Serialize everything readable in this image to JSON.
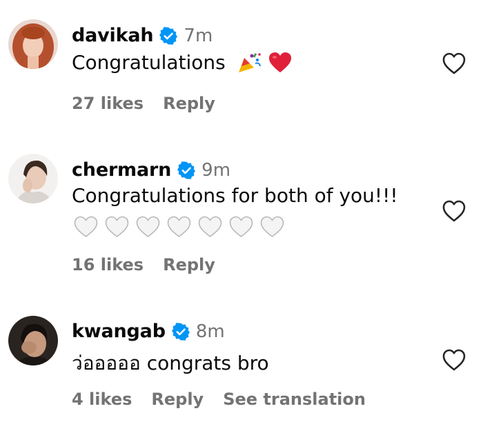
{
  "comments": [
    {
      "username": "davikah",
      "time": "7m",
      "text": "Congratulations",
      "emojis": [
        "party-popper",
        "red-heart"
      ],
      "likes": "27 likes",
      "reply": "Reply"
    },
    {
      "username": "chermarn",
      "time": "9m",
      "text": "Congratulations for both of you!!!",
      "emojis": [
        "white-heart",
        "white-heart",
        "white-heart",
        "white-heart",
        "white-heart",
        "white-heart",
        "white-heart"
      ],
      "likes": "16 likes",
      "reply": "Reply"
    },
    {
      "username": "kwangab",
      "time": "8m",
      "text": "ว่อออออ congrats bro",
      "likes": "4 likes",
      "reply": "Reply",
      "see_translation": "See translation"
    }
  ],
  "colors": {
    "verified": "#0095f6",
    "meta_text": "#737373",
    "red_heart": "#e0203a"
  }
}
